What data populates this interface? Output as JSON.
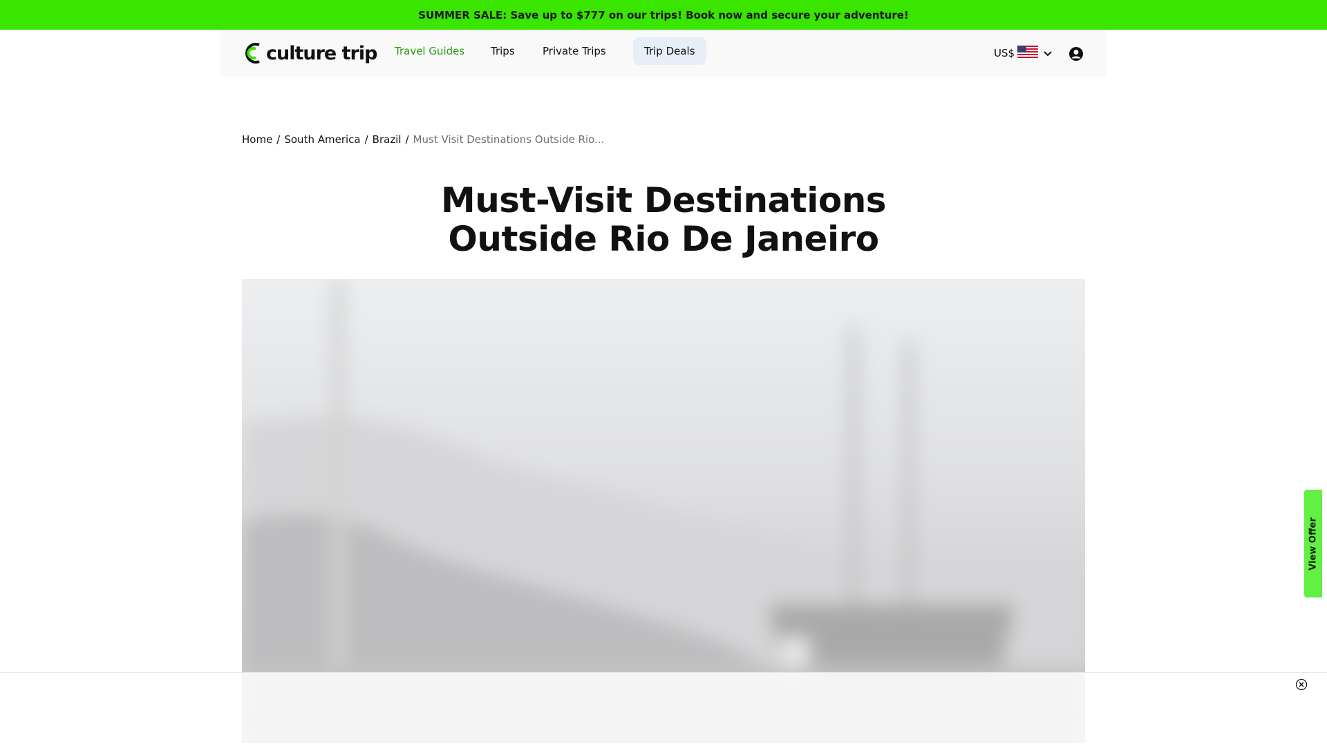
{
  "promo": {
    "text": "SUMMER SALE: Save up to $777 on our trips! Book now and secure your adventure!",
    "color": "#3ae500"
  },
  "header": {
    "logo_text": "culture trip",
    "logo_icon": "culture-trip-logo-icon",
    "nav": [
      {
        "label": "Travel Guides",
        "active": true
      },
      {
        "label": "Trips",
        "active": false
      },
      {
        "label": "Private Trips",
        "active": false
      },
      {
        "label": "Trip Deals",
        "active": false
      }
    ],
    "currency": "US$",
    "currency_flag": "us-flag-icon",
    "account_icon": "user-account-icon"
  },
  "breadcrumb": {
    "items": [
      "Home",
      "South America",
      "Brazil"
    ],
    "separator": "/",
    "current": "Must Visit Destinations Outside Rio..."
  },
  "article": {
    "title_line1": "Must-Visit Destinations",
    "title_line2": "Outside Rio De Janeiro"
  },
  "side_tab": {
    "label": "View Offer"
  },
  "ad": {
    "close_icon": "close-icon"
  },
  "colors": {
    "accent_green": "#3ae500",
    "nav_active": "#2c9a12",
    "pill_bg": "#e6eef8"
  }
}
